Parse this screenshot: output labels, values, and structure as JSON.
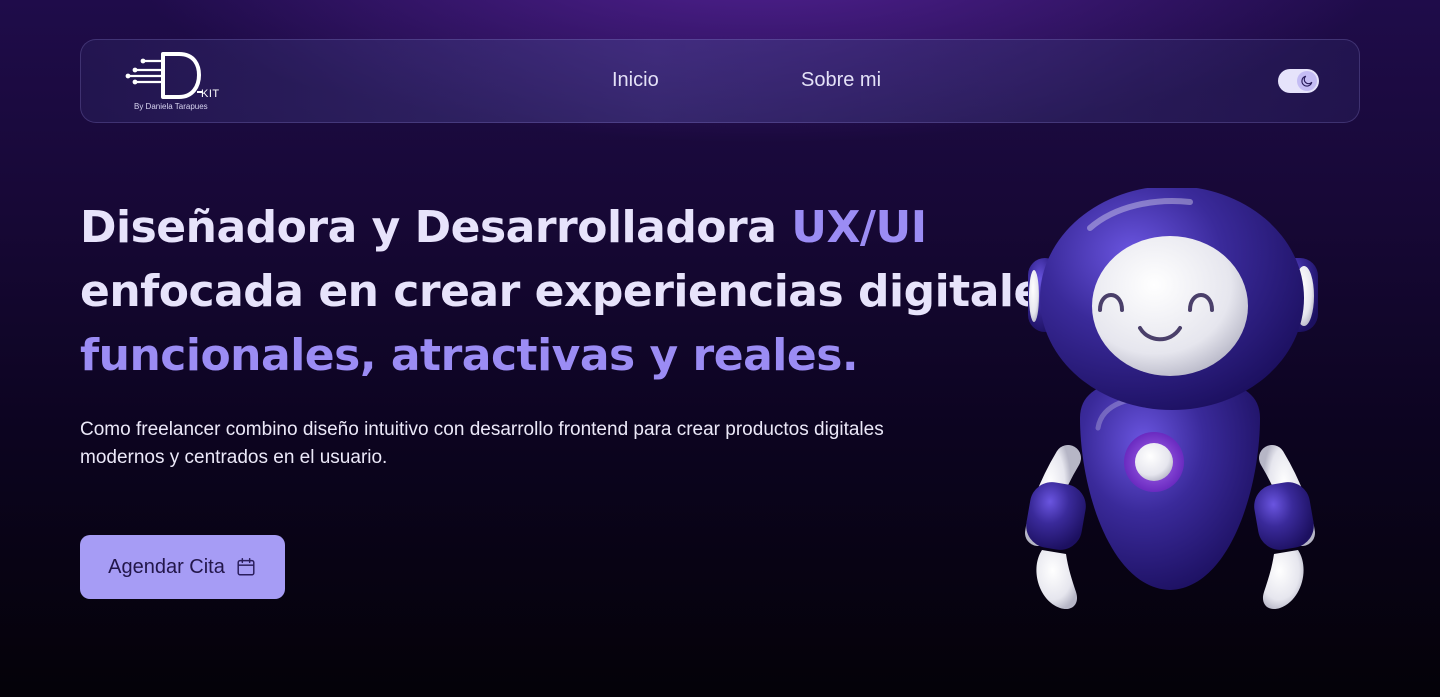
{
  "nav": {
    "logo": {
      "mark": "D",
      "suffix": "KIT",
      "byline": "By Daniela Tarapues"
    },
    "links": [
      {
        "label": "Inicio"
      },
      {
        "label": "Sobre mi"
      }
    ],
    "theme_toggle": {
      "icon": "moon-icon",
      "state": "dark"
    }
  },
  "hero": {
    "title": {
      "line1": "Diseñadora y Desarrolladora ",
      "line1_accent": "UX/UI",
      "line2": "enfocada en crear experiencias digitales",
      "line3_accent": "funcionales, atractivas y reales."
    },
    "description": "Como freelancer combino diseño intuitivo con desarrollo frontend para crear productos digitales modernos y centrados en el usuario.",
    "cta": {
      "label": "Agendar Cita",
      "icon": "calendar-icon"
    },
    "illustration": "robot-mascot"
  },
  "colors": {
    "accent": "#9b8cf4",
    "button_bg": "#a69cf5",
    "background_top": "#1f0c4a",
    "background_bottom": "#040208"
  }
}
